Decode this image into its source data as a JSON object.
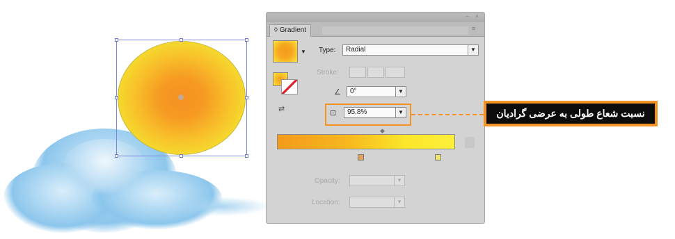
{
  "panel": {
    "tab_label": "Gradient",
    "type_label": "Type:",
    "type_value": "Radial",
    "stroke_label": "Stroke:",
    "angle_value": "0°",
    "aspect_value": "95.8%",
    "opacity_label": "Opacity:",
    "location_label": "Location:",
    "dropdown_arrow": "▼",
    "icons": [
      "gradient-swatch-icon",
      "fill-stroke-icon",
      "reverse-gradient-icon",
      "angle-icon",
      "aspect-ratio-icon",
      "delete-stop-icon"
    ]
  },
  "annotation": {
    "callout_text": "نسبت شعاع طولی به عرضی گرادیان"
  },
  "colors": {
    "accent": "#f39325",
    "gradient_start": "#f39a1c",
    "gradient_end": "#fdf03a",
    "panel_bg": "#d3d3d3"
  }
}
